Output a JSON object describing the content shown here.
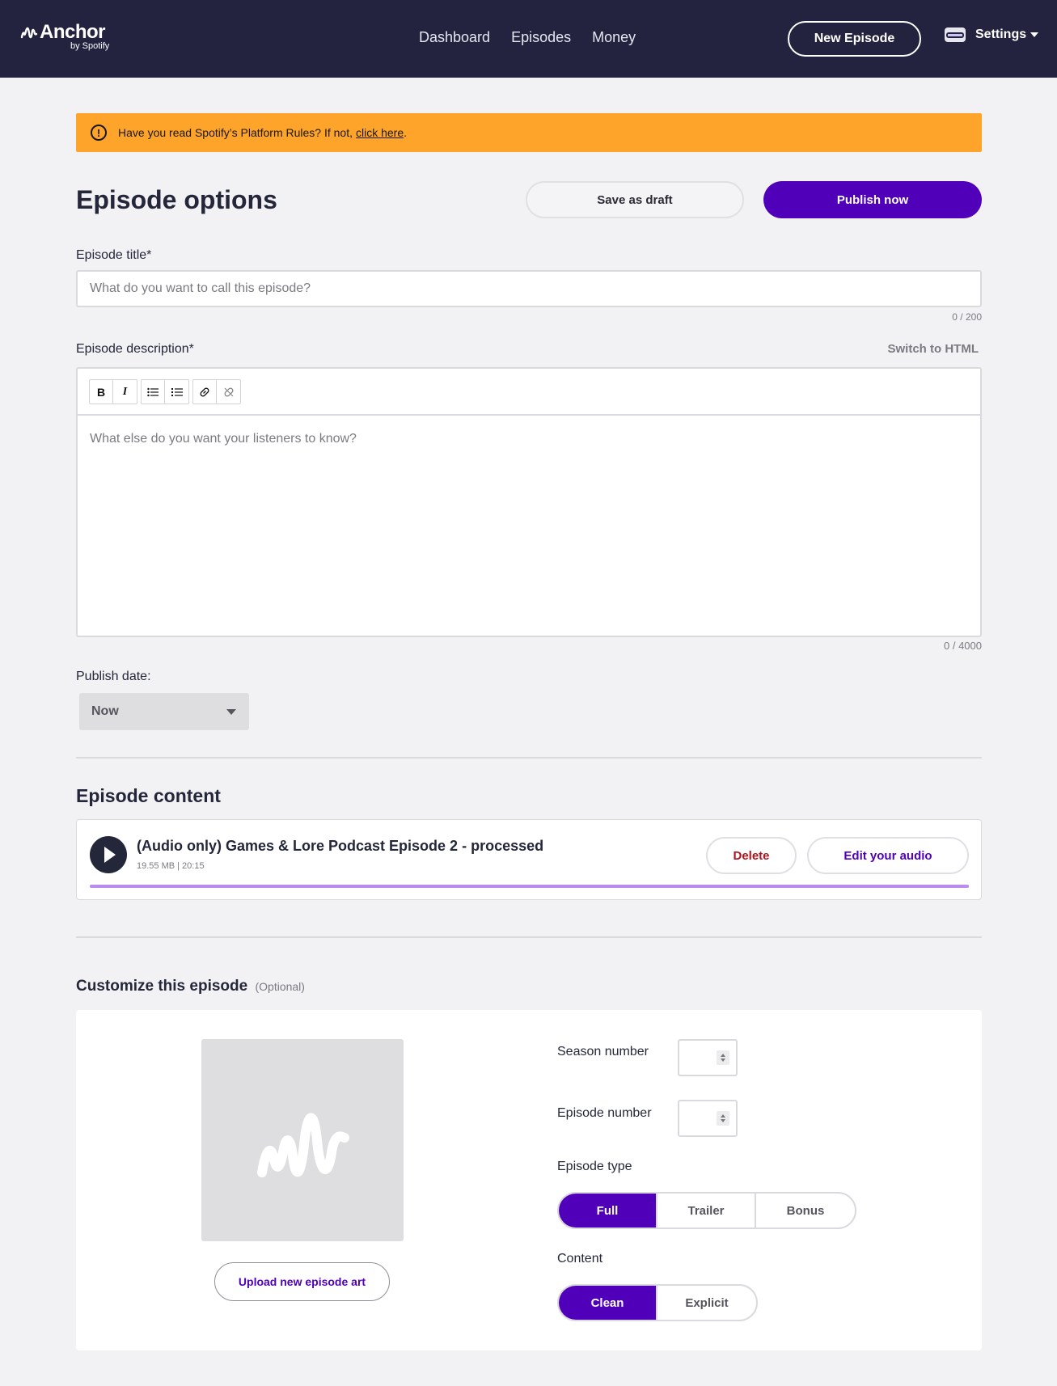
{
  "nav": {
    "logo_text": "Anchor",
    "logo_sub": "by Spotify",
    "links": [
      "Dashboard",
      "Episodes",
      "Money"
    ],
    "new_episode": "New Episode",
    "settings": "Settings"
  },
  "alert": {
    "text": "Have you read Spotify’s Platform Rules? If not,",
    "link": "click here",
    "suffix": "."
  },
  "header": {
    "title": "Episode options",
    "save_draft": "Save as draft",
    "publish_now": "Publish now"
  },
  "form": {
    "title_label": "Episode title*",
    "title_placeholder": "What do you want to call this episode?",
    "title_counter": "0 / 200",
    "desc_label": "Episode description*",
    "switch_html": "Switch to HTML",
    "desc_placeholder": "What else do you want your listeners to know?",
    "desc_counter": "0 / 4000",
    "publish_date_label": "Publish date:",
    "publish_date_value": "Now"
  },
  "episode_content": {
    "section_title": "Episode content",
    "audio_title": "(Audio only) Games & Lore Podcast Episode 2 - processed",
    "audio_meta": "19.55 MB | 20:15",
    "delete": "Delete",
    "edit_audio": "Edit your audio",
    "progress": 1.0
  },
  "customize": {
    "title": "Customize this episode",
    "optional": "(Optional)",
    "upload_art": "Upload new episode art",
    "season_label": "Season number",
    "episode_label": "Episode number",
    "type_label": "Episode type",
    "types": [
      "Full",
      "Trailer",
      "Bonus"
    ],
    "type_selected": "Full",
    "content_label": "Content",
    "content_options": [
      "Clean",
      "Explicit"
    ],
    "content_selected": "Clean"
  },
  "colors": {
    "brand_purple": "#5000b9",
    "nav_bg": "#232340",
    "alert_bg": "#ffa42b",
    "progress": "#b98bf0"
  }
}
